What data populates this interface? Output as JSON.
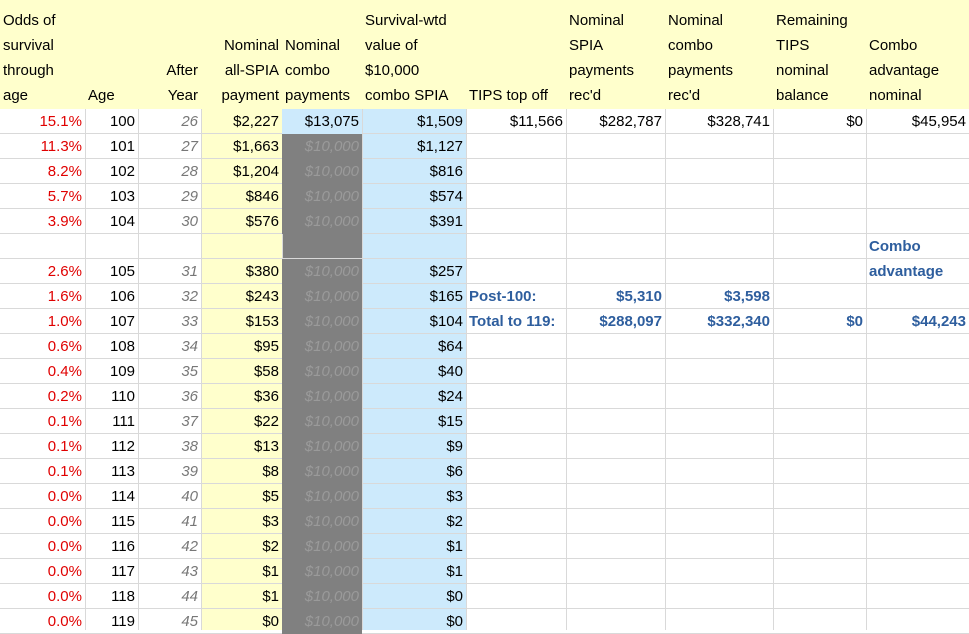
{
  "headers": {
    "odds": [
      "Odds of",
      "survival",
      "through",
      "age"
    ],
    "age": [
      "Age"
    ],
    "after": [
      "After",
      "Year"
    ],
    "all_spia": [
      "Nominal",
      "all-SPIA",
      "payment"
    ],
    "combo_pay": [
      "Nominal",
      "combo",
      "payments"
    ],
    "survival_wtd": [
      "Survival-wtd",
      "value of",
      "$10,000",
      "combo SPIA"
    ],
    "tips_top": [
      "TIPS top off"
    ],
    "spia_recd": [
      "Nominal",
      "SPIA",
      "payments",
      "rec'd"
    ],
    "combo_recd": [
      "Nominal",
      "combo",
      "payments",
      "rec'd"
    ],
    "remaining_tips": [
      "Remaining",
      "TIPS",
      "nominal",
      "balance"
    ],
    "combo_adv": [
      "Combo",
      "advantage",
      "nominal"
    ]
  },
  "rows": [
    {
      "odds": "15.1%",
      "age": "100",
      "year": "26",
      "spia": "$2,227",
      "combo": "$13,075",
      "wtd": "$1,509"
    },
    {
      "odds": "11.3%",
      "age": "101",
      "year": "27",
      "spia": "$1,663",
      "combo": "$10,000",
      "wtd": "$1,127"
    },
    {
      "odds": "8.2%",
      "age": "102",
      "year": "28",
      "spia": "$1,204",
      "combo": "$10,000",
      "wtd": "$816"
    },
    {
      "odds": "5.7%",
      "age": "103",
      "year": "29",
      "spia": "$846",
      "combo": "$10,000",
      "wtd": "$574"
    },
    {
      "odds": "3.9%",
      "age": "104",
      "year": "30",
      "spia": "$576",
      "combo": "$10,000",
      "wtd": "$391"
    },
    {
      "odds": "2.6%",
      "age": "105",
      "year": "31",
      "spia": "$380",
      "combo": "$10,000",
      "wtd": "$257"
    },
    {
      "odds": "1.6%",
      "age": "106",
      "year": "32",
      "spia": "$243",
      "combo": "$10,000",
      "wtd": "$165"
    },
    {
      "odds": "1.0%",
      "age": "107",
      "year": "33",
      "spia": "$153",
      "combo": "$10,000",
      "wtd": "$104"
    },
    {
      "odds": "0.6%",
      "age": "108",
      "year": "34",
      "spia": "$95",
      "combo": "$10,000",
      "wtd": "$64"
    },
    {
      "odds": "0.4%",
      "age": "109",
      "year": "35",
      "spia": "$58",
      "combo": "$10,000",
      "wtd": "$40"
    },
    {
      "odds": "0.2%",
      "age": "110",
      "year": "36",
      "spia": "$36",
      "combo": "$10,000",
      "wtd": "$24"
    },
    {
      "odds": "0.1%",
      "age": "111",
      "year": "37",
      "spia": "$22",
      "combo": "$10,000",
      "wtd": "$15"
    },
    {
      "odds": "0.1%",
      "age": "112",
      "year": "38",
      "spia": "$13",
      "combo": "$10,000",
      "wtd": "$9"
    },
    {
      "odds": "0.1%",
      "age": "113",
      "year": "39",
      "spia": "$8",
      "combo": "$10,000",
      "wtd": "$6"
    },
    {
      "odds": "0.0%",
      "age": "114",
      "year": "40",
      "spia": "$5",
      "combo": "$10,000",
      "wtd": "$3"
    },
    {
      "odds": "0.0%",
      "age": "115",
      "year": "41",
      "spia": "$3",
      "combo": "$10,000",
      "wtd": "$2"
    },
    {
      "odds": "0.0%",
      "age": "116",
      "year": "42",
      "spia": "$2",
      "combo": "$10,000",
      "wtd": "$1"
    },
    {
      "odds": "0.0%",
      "age": "117",
      "year": "43",
      "spia": "$1",
      "combo": "$10,000",
      "wtd": "$1"
    },
    {
      "odds": "0.0%",
      "age": "118",
      "year": "44",
      "spia": "$1",
      "combo": "$10,000",
      "wtd": "$0"
    },
    {
      "odds": "0.0%",
      "age": "119",
      "year": "45",
      "spia": "$0",
      "combo": "$10,000",
      "wtd": "$0"
    }
  ],
  "first_row_extra": {
    "tips_top": "$11,566",
    "spia_recd": "$282,787",
    "combo_recd": "$328,741",
    "remaining_tips": "$0",
    "combo_adv": "$45,954"
  },
  "summary": {
    "combo_adv_label": [
      "Combo",
      "advantage"
    ],
    "post100": {
      "label": "Post-100:",
      "spia": "$5,310",
      "combo": "$3,598"
    },
    "total119": {
      "label": "Total to 119:",
      "spia": "$288,097",
      "combo": "$332,340",
      "tips": "$0",
      "adv": "$44,243"
    }
  }
}
